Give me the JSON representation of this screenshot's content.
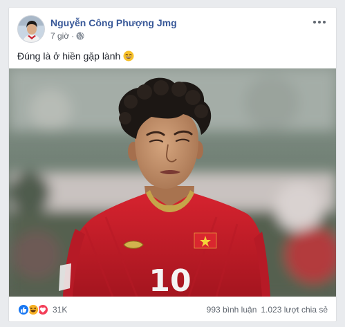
{
  "post": {
    "author": "Nguyễn Công Phượng Jmg",
    "time": "7 giờ",
    "separator": "·",
    "privacy_icon": "globe-icon",
    "more_icon": "more-options-icon",
    "text": "Đúng là ở hiền gặp lành",
    "text_emoji": "grinning-face-emoji",
    "photo": {
      "subject": "player-in-red-jersey",
      "jersey_number": "10"
    }
  },
  "footer": {
    "reaction_icons": [
      "like-icon",
      "haha-icon",
      "love-icon"
    ],
    "reaction_count": "31K",
    "comments": "993 bình luận",
    "shares": "1.023 lượt chia sẻ"
  },
  "colors": {
    "link": "#385898",
    "meta": "#616770",
    "like": "#1877f2",
    "love": "#f33e58",
    "haha": "#f7b125",
    "jersey": "#c8202f"
  }
}
